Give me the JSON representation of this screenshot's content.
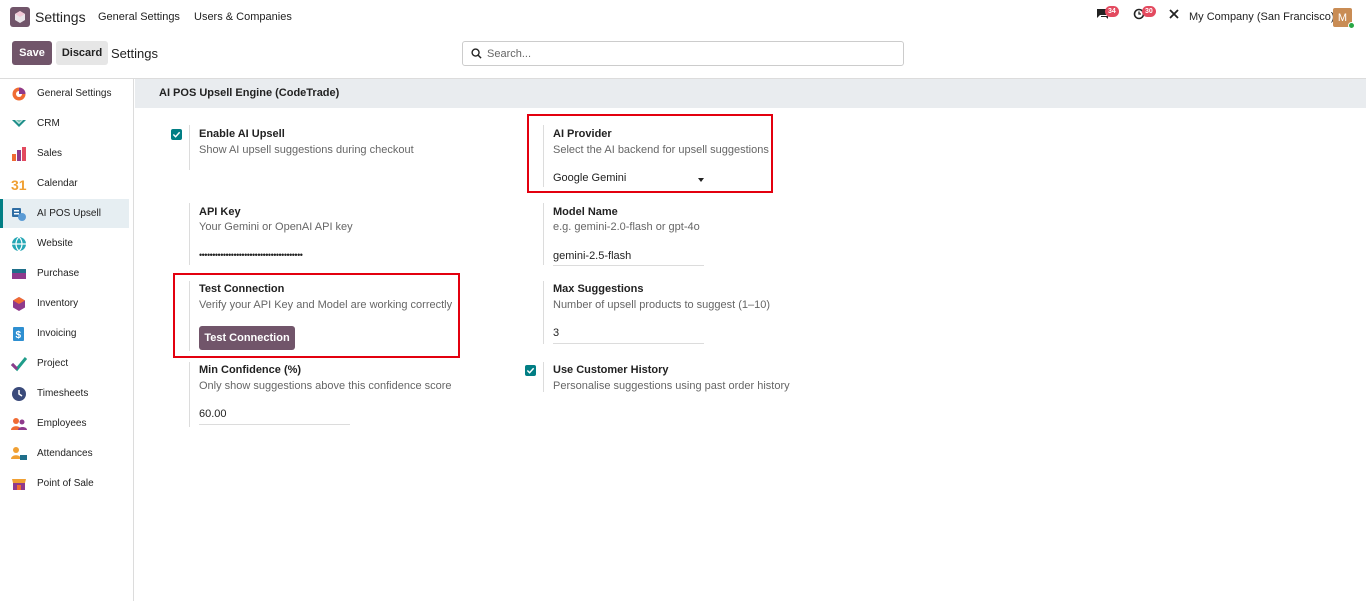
{
  "navbar": {
    "app_title": "Settings",
    "menu": [
      "General Settings",
      "Users & Companies"
    ],
    "messages_count": "34",
    "activities_count": "30",
    "company": "My Company (San Francisco)",
    "avatar_initial": "M"
  },
  "control_panel": {
    "save_label": "Save",
    "discard_label": "Discard",
    "breadcrumb": "Settings",
    "search_placeholder": "Search..."
  },
  "sidebar": {
    "items": [
      {
        "label": "General Settings",
        "icon": "general-settings-icon"
      },
      {
        "label": "CRM",
        "icon": "crm-icon"
      },
      {
        "label": "Sales",
        "icon": "sales-icon"
      },
      {
        "label": "Calendar",
        "icon": "calendar-icon"
      },
      {
        "label": "AI POS Upsell",
        "icon": "ai-pos-upsell-icon"
      },
      {
        "label": "Website",
        "icon": "website-icon"
      },
      {
        "label": "Purchase",
        "icon": "purchase-icon"
      },
      {
        "label": "Inventory",
        "icon": "inventory-icon"
      },
      {
        "label": "Invoicing",
        "icon": "invoicing-icon"
      },
      {
        "label": "Project",
        "icon": "project-icon"
      },
      {
        "label": "Timesheets",
        "icon": "timesheets-icon"
      },
      {
        "label": "Employees",
        "icon": "employees-icon"
      },
      {
        "label": "Attendances",
        "icon": "attendances-icon"
      },
      {
        "label": "Point of Sale",
        "icon": "point-of-sale-icon"
      }
    ],
    "active_index": 4,
    "calendar_day": "31"
  },
  "section": {
    "title": "AI POS Upsell Engine (CodeTrade)"
  },
  "settings": {
    "enable_ai": {
      "label": "Enable AI Upsell",
      "help": "Show AI upsell suggestions during checkout",
      "checked": true
    },
    "ai_provider": {
      "label": "AI Provider",
      "help": "Select the AI backend for upsell suggestions",
      "value": "Google Gemini"
    },
    "api_key": {
      "label": "API Key",
      "help": "Your Gemini or OpenAI API key",
      "value": "•••••••••••••••••••••••••••••••••••••••"
    },
    "model_name": {
      "label": "Model Name",
      "help": "e.g. gemini-2.0-flash or gpt-4o",
      "value": "gemini-2.5-flash"
    },
    "test_connection": {
      "label": "Test Connection",
      "help": "Verify your API Key and Model are working correctly",
      "button": "Test Connection"
    },
    "max_suggestions": {
      "label": "Max Suggestions",
      "help": "Number of upsell products to suggest (1–10)",
      "value": "3"
    },
    "min_confidence": {
      "label": "Min Confidence (%)",
      "help": "Only show suggestions above this confidence score",
      "value": "60.00"
    },
    "customer_history": {
      "label": "Use Customer History",
      "help": "Personalise suggestions using past order history",
      "checked": true
    }
  },
  "colors": {
    "brand": "#71556a",
    "teal": "#017e84",
    "highlight": "#e3000f",
    "badge": "#e34a5f"
  }
}
